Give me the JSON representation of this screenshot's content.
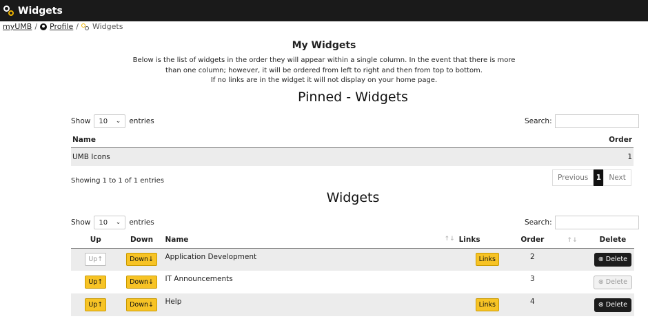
{
  "window": {
    "title": "Widgets",
    "icon": "gears-icon"
  },
  "breadcrumb": {
    "home": "myUMB",
    "sep": "/",
    "profile": "Profile",
    "current": "Widgets"
  },
  "heading": "My Widgets",
  "description": [
    "Below is the list of widgets in the order they will appear within a single column. In the event that there is more",
    "than one column; however, it will be ordered from left to right and then from top to bottom.",
    "If no links are in the widget it will not display on your home page."
  ],
  "pinned": {
    "title": "Pinned - Widgets",
    "show_label": "Show",
    "entries_value": "10",
    "entries_label": "entries",
    "search_label": "Search:",
    "columns": {
      "name": "Name",
      "order": "Order"
    },
    "rows": [
      {
        "name": "UMB Icons",
        "order": "1"
      }
    ],
    "info": "Showing 1 to 1 of 1 entries",
    "pager": {
      "previous": "Previous",
      "current": "1",
      "next": "Next"
    }
  },
  "widgets": {
    "title": "Widgets",
    "show_label": "Show",
    "entries_value": "10",
    "entries_label": "entries",
    "search_label": "Search:",
    "columns": {
      "up": "Up",
      "down": "Down",
      "name": "Name",
      "links": "Links",
      "order": "Order",
      "delete": "Delete"
    },
    "up_label": "Up",
    "up_arrow": "↑",
    "down_label": "Down",
    "down_arrow": "↓",
    "links_label": "Links",
    "delete_label": "Delete",
    "rows": [
      {
        "name": "Application Development",
        "order": "2",
        "up_enabled": false,
        "has_links": true,
        "delete_enabled": true
      },
      {
        "name": "IT Announcements",
        "order": "3",
        "up_enabled": true,
        "has_links": false,
        "delete_enabled": false
      },
      {
        "name": "Help",
        "order": "4",
        "up_enabled": true,
        "has_links": true,
        "delete_enabled": true
      }
    ]
  },
  "colors": {
    "titlebar": "#1a1a1a",
    "button_yellow": "#f7c325",
    "delete_dark": "#1c1c1c",
    "accent_gear": "#f0b400"
  }
}
